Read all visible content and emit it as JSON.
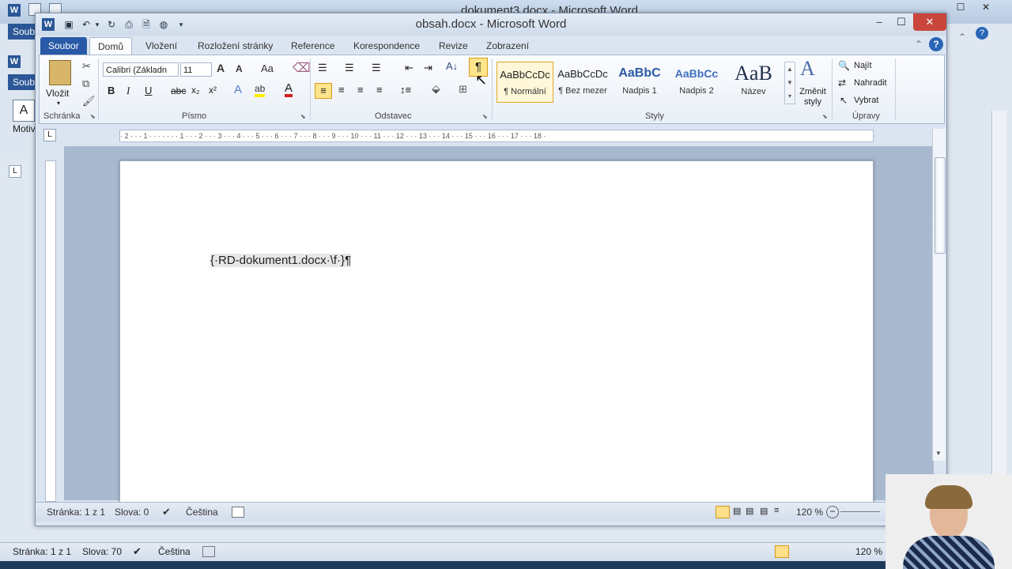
{
  "background_window": {
    "title": "dokument3.docx - Microsoft Word",
    "tab_file": "Soub",
    "tab_file2": "Soub",
    "style_label": "Motiv",
    "status": {
      "page": "Stránka: 1 z 1",
      "words": "Slova: 70",
      "language": "Čeština",
      "zoom": "120 %"
    }
  },
  "window": {
    "title": "obsah.docx - Microsoft Word",
    "controls": {
      "minimize": "–",
      "maximize": "☐",
      "close": "✕"
    }
  },
  "tabs": [
    "Soubor",
    "Domů",
    "Vložení",
    "Rozložení stránky",
    "Reference",
    "Korespondence",
    "Revize",
    "Zobrazení"
  ],
  "ribbon": {
    "clipboard": {
      "paste": "Vložit",
      "group": "Schránka"
    },
    "font": {
      "name": "Calibri (Základn",
      "size": "11",
      "bold": "B",
      "italic": "I",
      "underline": "U",
      "strike": "abc",
      "subscript": "x₂",
      "superscript": "x²",
      "group": "Písmo"
    },
    "paragraph": {
      "group": "Odstavec",
      "pilcrow": "¶"
    },
    "styles": {
      "items": [
        {
          "sample": "AaBbCcDc",
          "name": "¶ Normální"
        },
        {
          "sample": "AaBbCcDc",
          "name": "¶ Bez mezer"
        },
        {
          "sample": "AaBbC",
          "name": "Nadpis 1"
        },
        {
          "sample": "AaBbCc",
          "name": "Nadpis 2"
        },
        {
          "sample": "AaB",
          "name": "Název"
        }
      ],
      "change": "Změnit styly",
      "group": "Styly"
    },
    "editing": {
      "find": "Najít",
      "replace": "Nahradit",
      "select": "Vybrat",
      "group": "Úpravy"
    }
  },
  "ruler": "· 2 · · · 1 · · · · · · · 1 · · · 2 · · · 3 · · · 4 · · · 5 · · · 6 · · · 7 · · · 8 · · · 9 · · · 10 · · · 11 · · · 12 · · · 13 · · · 14 · · · 15 · · · 16 · · · 17 · · · 18 ·",
  "document": {
    "field_code": "{·RD-dokument1.docx·\\f·}¶"
  },
  "status": {
    "page": "Stránka: 1 z 1",
    "words": "Slova: 0",
    "language": "Čeština",
    "zoom": "120 %"
  },
  "colors": {
    "accent": "#2a5aa7",
    "highlight": "#ffef14",
    "close": "#c9463d"
  }
}
